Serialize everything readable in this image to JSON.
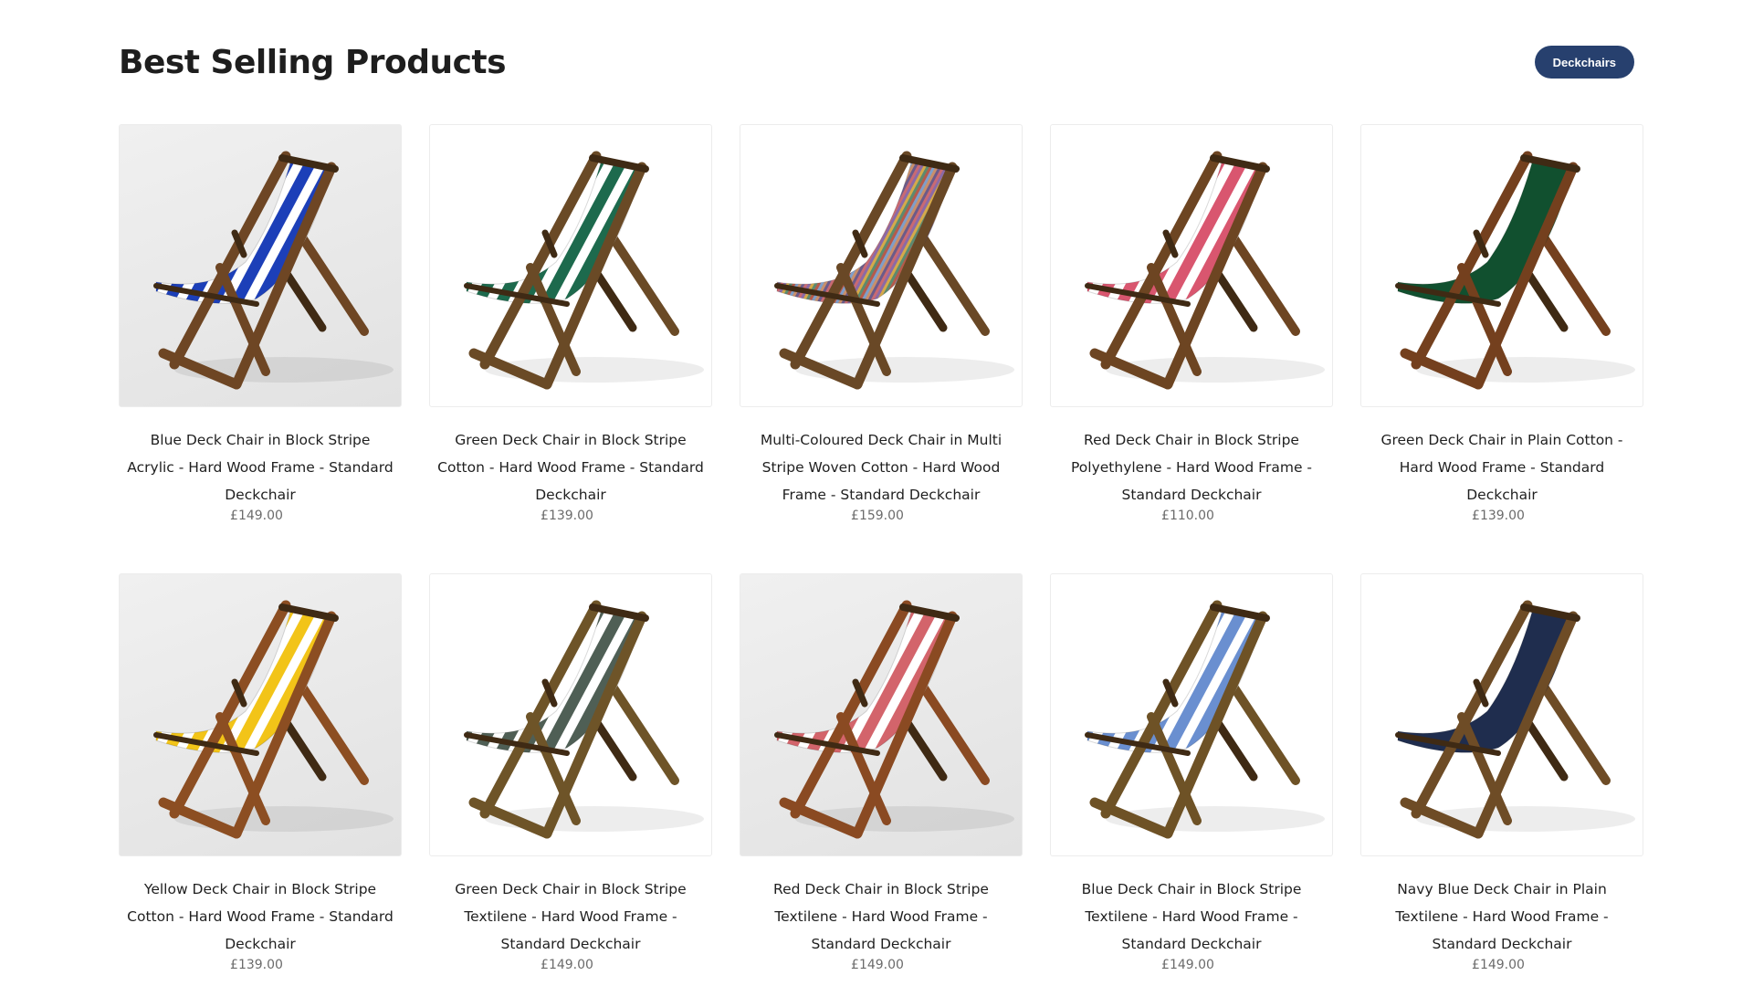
{
  "section": {
    "title": "Best Selling Products",
    "filter_label": "Deckchairs"
  },
  "products": [
    {
      "name": "Blue Deck Chair in Block Stripe Acrylic - Hard Wood Frame - Standard Deckchair",
      "price": "£149.00",
      "fabric": "stripe",
      "c1": "#1c3fb8",
      "c2": "#ffffff",
      "bg": "grey",
      "wood": "#6e4624"
    },
    {
      "name": "Green Deck Chair in Block Stripe Cotton - Hard Wood Frame - Standard Deckchair",
      "price": "£139.00",
      "fabric": "stripe",
      "c1": "#1d6a4d",
      "c2": "#ffffff",
      "bg": "white",
      "wood": "#6a4a26"
    },
    {
      "name": "Multi-Coloured Deck Chair in Multi Stripe Woven Cotton - Hard Wood Frame - Standard Deckchair",
      "price": "£159.00",
      "fabric": "multi",
      "c1": "#b8737c",
      "c2": "#c9a060",
      "bg": "white",
      "wood": "#694826"
    },
    {
      "name": "Red Deck Chair in Block Stripe Polyethylene - Hard Wood Frame - Standard Deckchair",
      "price": "£110.00",
      "fabric": "stripe",
      "c1": "#d9566f",
      "c2": "#ffffff",
      "bg": "white",
      "wood": "#6d4522"
    },
    {
      "name": "Green Deck Chair in Plain Cotton - Hard Wood Frame - Standard Deckchair",
      "price": "£139.00",
      "fabric": "plain",
      "c1": "#11502f",
      "c2": "#11502f",
      "bg": "white",
      "wood": "#74401e"
    },
    {
      "name": "Yellow Deck Chair in Block Stripe Cotton - Hard Wood Frame - Standard Deckchair",
      "price": "£139.00",
      "fabric": "stripe",
      "c1": "#f2c418",
      "c2": "#ffffff",
      "bg": "grey",
      "wood": "#8c4e22"
    },
    {
      "name": "Green Deck Chair in Block Stripe Textilene - Hard Wood Frame - Standard Deckchair",
      "price": "£149.00",
      "fabric": "stripe",
      "c1": "#4f5f55",
      "c2": "#ffffff",
      "bg": "white",
      "wood": "#6e5428"
    },
    {
      "name": "Red Deck Chair in Block Stripe Textilene - Hard Wood Frame - Standard Deckchair",
      "price": "£149.00",
      "fabric": "stripe",
      "c1": "#d3646b",
      "c2": "#ffffff",
      "bg": "grey",
      "wood": "#8a4a22"
    },
    {
      "name": "Blue Deck Chair in Block Stripe Textilene - Hard Wood Frame - Standard Deckchair",
      "price": "£149.00",
      "fabric": "stripe",
      "c1": "#6a8fd0",
      "c2": "#ffffff",
      "bg": "white",
      "wood": "#6e5226"
    },
    {
      "name": "Navy Blue Deck Chair in Plain Textilene - Hard Wood Frame - Standard Deckchair",
      "price": "£149.00",
      "fabric": "plain",
      "c1": "#1f2d4e",
      "c2": "#1f2d4e",
      "bg": "white",
      "wood": "#6e4c26"
    }
  ]
}
